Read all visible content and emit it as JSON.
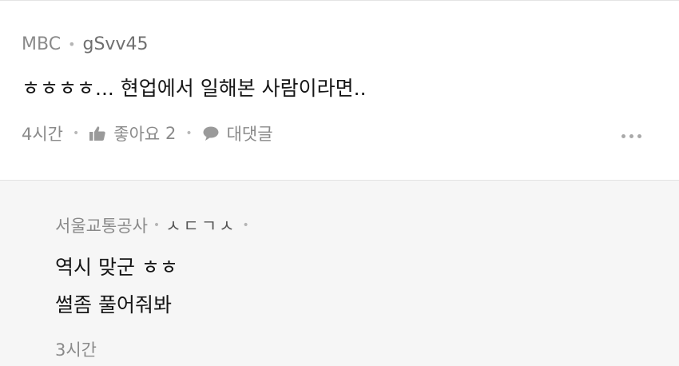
{
  "comment": {
    "source": "MBC",
    "author": "gSvv45",
    "text": "ㅎㅎㅎㅎ... 현업에서 일해본 사람이라면..",
    "time": "4시간",
    "like_label": "좋아요",
    "like_count": "2",
    "reply_label": "대댓글",
    "like_icon": "thumbs-up-icon",
    "reply_icon": "speech-bubble-icon",
    "more_icon": "more-dots-icon"
  },
  "reply": {
    "source": "서울교통공사",
    "author": "ㅅㄷㄱㅅ",
    "line1": "역시 맞군 ㅎㅎ",
    "line2": "썰좀 풀어줘봐",
    "time": "3시간"
  },
  "colors": {
    "reply_background": "#f6f6f6",
    "meta_text": "#8a8a8a",
    "body_text": "#161616"
  }
}
